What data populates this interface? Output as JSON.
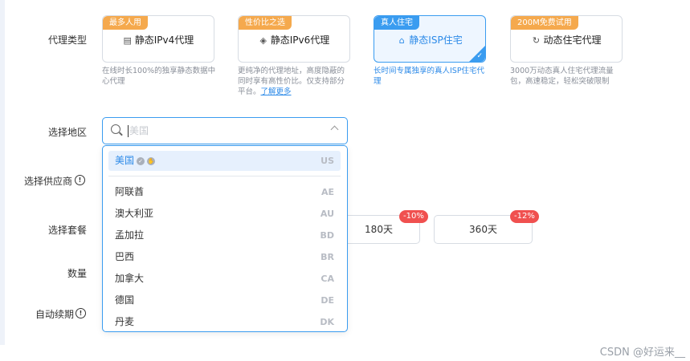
{
  "labels": {
    "proxy_type": "代理类型",
    "region": "选择地区",
    "supplier": "选择供应商",
    "package": "选择套餐",
    "quantity": "数量",
    "auto_renew": "自动续期"
  },
  "proxy_cards": [
    {
      "badge": "最多人用",
      "icon": "server-icon",
      "title": "静态IPv4代理",
      "desc": "在线时长100%的独享静态数据中心代理",
      "selected": false
    },
    {
      "badge": "性价比之选",
      "icon": "layers-icon",
      "title": "静态IPv6代理",
      "desc": "更纯净的代理地址，高度隐蔽的同时享有高性价比。仅支持部分平台。",
      "link": "了解更多",
      "selected": false
    },
    {
      "badge": "真人住宅",
      "icon": "home-icon",
      "title": "静态ISP住宅",
      "desc": "长时间专属独享的真人ISP住宅代理",
      "selected": true
    },
    {
      "badge": "200M免费试用",
      "icon": "refresh-icon",
      "title": "动态住宅代理",
      "desc": "3000万动态真人住宅代理流量包，高速稳定，轻松突破限制",
      "selected": false
    }
  ],
  "search": {
    "placeholder": "美国"
  },
  "countries": [
    {
      "name": "美国",
      "code": "US",
      "highlighted": true
    },
    {
      "name": "阿联酋",
      "code": "AE"
    },
    {
      "name": "澳大利亚",
      "code": "AU"
    },
    {
      "name": "孟加拉",
      "code": "BD"
    },
    {
      "name": "巴西",
      "code": "BR"
    },
    {
      "name": "加拿大",
      "code": "CA"
    },
    {
      "name": "德国",
      "code": "DE"
    },
    {
      "name": "丹麦",
      "code": "DK"
    }
  ],
  "packages": [
    {
      "label": "180天",
      "discount": "-10%"
    },
    {
      "label": "360天",
      "discount": "-12%"
    }
  ],
  "footer": "CSDN @好运来__",
  "colors": {
    "accent": "#3a9cf0",
    "badge": "#f5a94d",
    "discount": "#f0504f"
  }
}
